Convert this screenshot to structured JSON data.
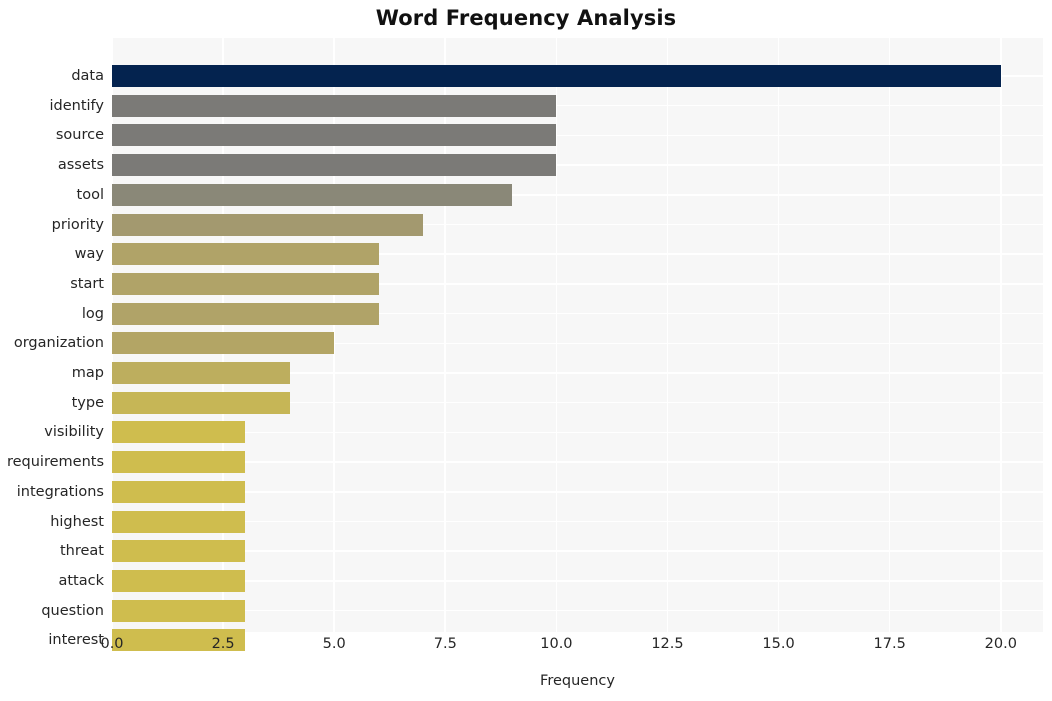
{
  "chart_data": {
    "type": "bar",
    "orientation": "horizontal",
    "title": "Word Frequency Analysis",
    "xlabel": "Frequency",
    "ylabel": "",
    "categories": [
      "data",
      "identify",
      "source",
      "assets",
      "tool",
      "priority",
      "way",
      "start",
      "log",
      "organization",
      "map",
      "type",
      "visibility",
      "requirements",
      "integrations",
      "highest",
      "threat",
      "attack",
      "question",
      "interest"
    ],
    "values": [
      20,
      10,
      10,
      10,
      9,
      7,
      6,
      6,
      6,
      5,
      4,
      4,
      3,
      3,
      3,
      3,
      3,
      3,
      3,
      3
    ],
    "bar_colors": [
      "#04234f",
      "#7b7a77",
      "#7b7a77",
      "#7b7a77",
      "#8a8878",
      "#a3996f",
      "#b0a368",
      "#b0a368",
      "#b0a368",
      "#b3a565",
      "#bdae5e",
      "#c6b656",
      "#cfbd4e",
      "#cfbd4e",
      "#cfbd4e",
      "#cfbd4e",
      "#cfbd4e",
      "#cfbd4e",
      "#cfbd4e",
      "#cfbd4e"
    ],
    "xticks": [
      0,
      2.5,
      5,
      7.5,
      10,
      12.5,
      15,
      17.5,
      20
    ],
    "xtick_labels": [
      "0.0",
      "2.5",
      "5.0",
      "7.5",
      "10.0",
      "12.5",
      "15.0",
      "17.5",
      "20.0"
    ],
    "xlim": [
      0,
      20.95
    ],
    "grid": true,
    "legend": false,
    "plot_background": "#f7f7f7",
    "gridline_color": "#ffffff",
    "figure_background": "#ffffff"
  }
}
